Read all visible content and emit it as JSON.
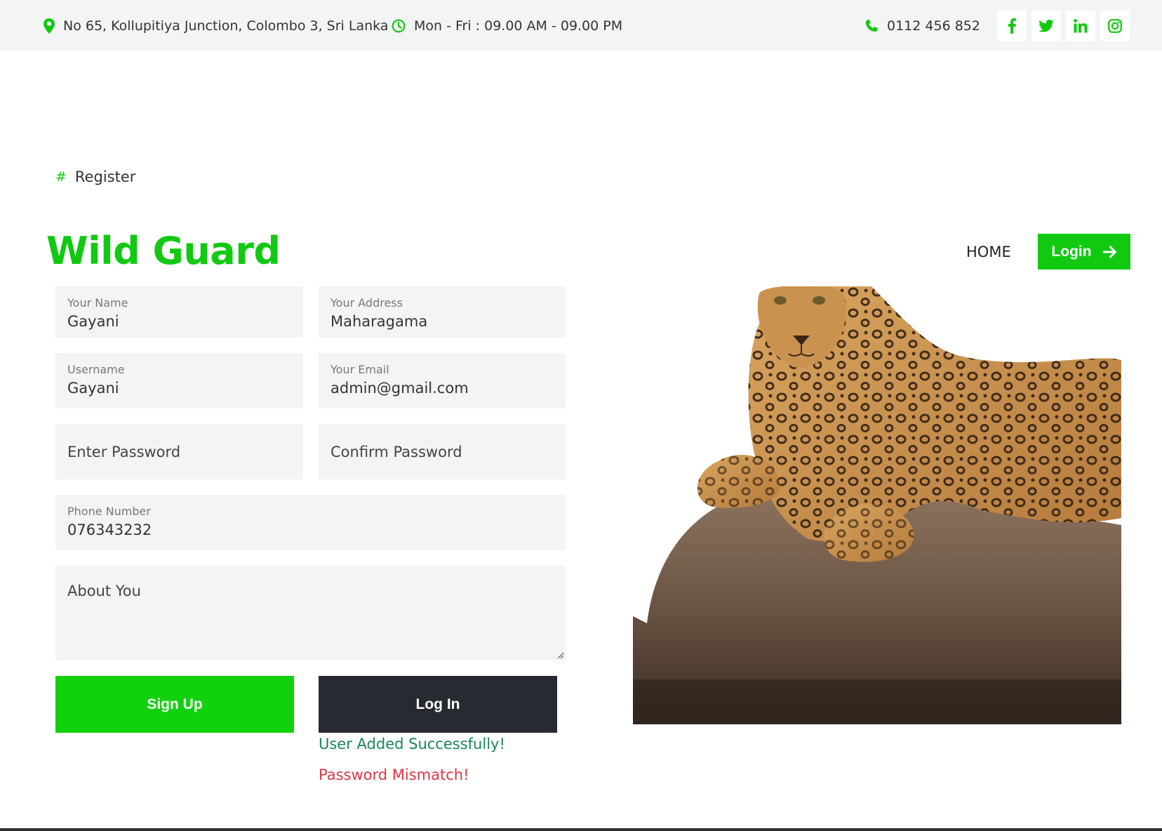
{
  "topbar": {
    "address": "No 65, Kollupitiya Junction, Colombo 3, Sri Lanka",
    "hours": "Mon - Fri : 09.00 AM - 09.00 PM",
    "phone": "0112 456 852",
    "social": [
      "facebook-icon",
      "twitter-icon",
      "linkedin-icon",
      "instagram-icon"
    ]
  },
  "breadcrumb": {
    "symbol": "#",
    "label": "Register"
  },
  "nav": {
    "brand": "Wild Guard",
    "home": "HOME",
    "login": "Login"
  },
  "form": {
    "name": {
      "label": "Your Name",
      "value": "Gayani"
    },
    "address": {
      "label": "Your Address",
      "value": "Maharagama"
    },
    "username": {
      "label": "Username",
      "value": "Gayani"
    },
    "email": {
      "label": "Your Email",
      "value": "admin@gmail.com"
    },
    "password": {
      "placeholder": "Enter Password"
    },
    "confirm_password": {
      "placeholder": "Confirm Password"
    },
    "phone": {
      "label": "Phone Number",
      "value": "076343232"
    },
    "about": {
      "placeholder": "About You"
    },
    "signup_label": "Sign Up",
    "login_label": "Log In"
  },
  "messages": {
    "success": "User Added Successfully!",
    "error": "Password Mismatch!"
  },
  "colors": {
    "brand_green": "#11c911",
    "dark_button": "#272b31",
    "success_text": "#198754",
    "error_text": "#dc3545",
    "field_bg": "#f3f4f6"
  }
}
